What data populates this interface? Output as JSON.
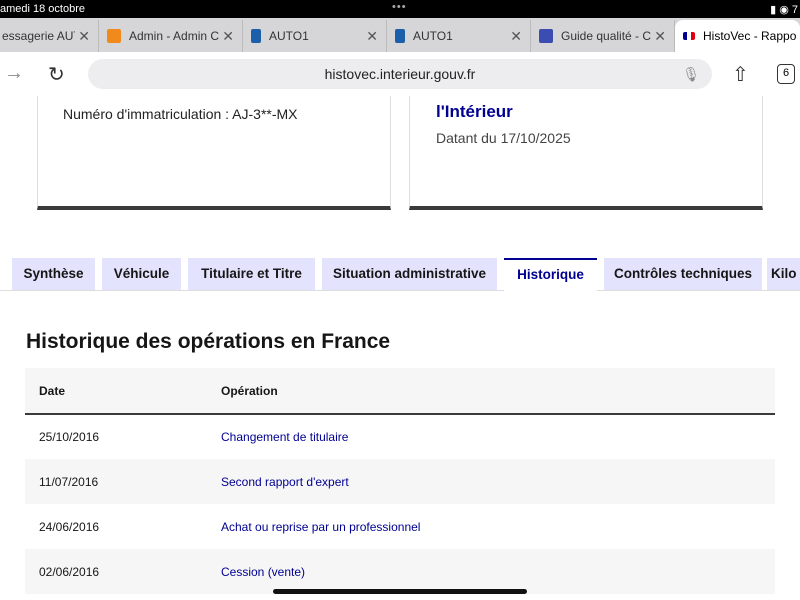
{
  "status": {
    "date": "amedi 18 octobre",
    "icons": "▮ ◉ 7"
  },
  "browser_tabs": [
    {
      "label": "essagerie AUT",
      "color": "#888"
    },
    {
      "label": "Admin - Admin C",
      "color": "#f08a1c"
    },
    {
      "label": "AUTO1",
      "color": "#1a5fa8"
    },
    {
      "label": "AUTO1",
      "color": "#1a5fa8"
    },
    {
      "label": "Guide qualité - C",
      "color": "#3b4db0"
    },
    {
      "label": "HistoVec - Rappo",
      "color": "#e1000f"
    }
  ],
  "url": "histovec.interieur.gouv.fr",
  "tab_count": "6",
  "card1": {
    "text": "Numéro d'immatriculation : AJ-3**-MX"
  },
  "card2": {
    "heading": "l'Intérieur",
    "text": "Datant du 17/10/2025"
  },
  "nav_tabs": [
    "Synthèse",
    "Véhicule",
    "Titulaire et Titre",
    "Situation administrative",
    "Historique",
    "Contrôles techniques",
    "Kilo"
  ],
  "active_tab": "Historique",
  "section_title": "Historique des opérations en France",
  "table": {
    "headers": [
      "Date",
      "Opération"
    ],
    "rows": [
      [
        "25/10/2016",
        "Changement de titulaire"
      ],
      [
        "11/07/2016",
        "Second rapport d'expert"
      ],
      [
        "24/06/2016",
        "Achat ou reprise par un professionnel"
      ],
      [
        "02/06/2016",
        "Cession (vente)"
      ]
    ]
  }
}
